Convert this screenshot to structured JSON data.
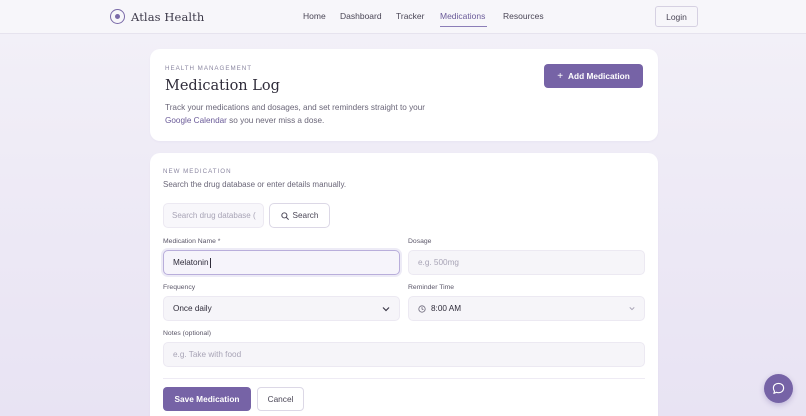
{
  "brand": {
    "name": "Atlas Health",
    "icon": "atlas-logo-icon"
  },
  "nav": {
    "links": [
      "Home",
      "Dashboard",
      "Tracker",
      "Medications",
      "Resources"
    ],
    "active": "Medications",
    "login_label": "Login"
  },
  "header": {
    "eyebrow": "HEALTH MANAGEMENT",
    "title": "Medication Log",
    "desc_before": "Track your medications and dosages, and set reminders straight to your ",
    "desc_link": "Google Calendar",
    "desc_after": " so you never miss a dose.",
    "add_label": "Add Medication"
  },
  "form": {
    "eyebrow": "NEW MEDICATION",
    "subtitle": "Search the drug database or enter details manually.",
    "search": {
      "placeholder": "Search drug database (",
      "button_label": "Search"
    },
    "med_name": {
      "label": "Medication Name *",
      "value": "Melatonin"
    },
    "dosage": {
      "label": "Dosage",
      "placeholder": "e.g. 500mg"
    },
    "frequency": {
      "label": "Frequency",
      "value": "Once daily"
    },
    "reminder": {
      "label": "Reminder Time",
      "value": "8:00 AM"
    },
    "notes": {
      "label": "Notes (optional)",
      "placeholder": "e.g. Take with food"
    },
    "save_label": "Save Medication",
    "cancel_label": "Cancel"
  },
  "colors": {
    "accent": "#7663a6",
    "page_bg": "#ece8f5",
    "card_bg": "#ffffff"
  }
}
